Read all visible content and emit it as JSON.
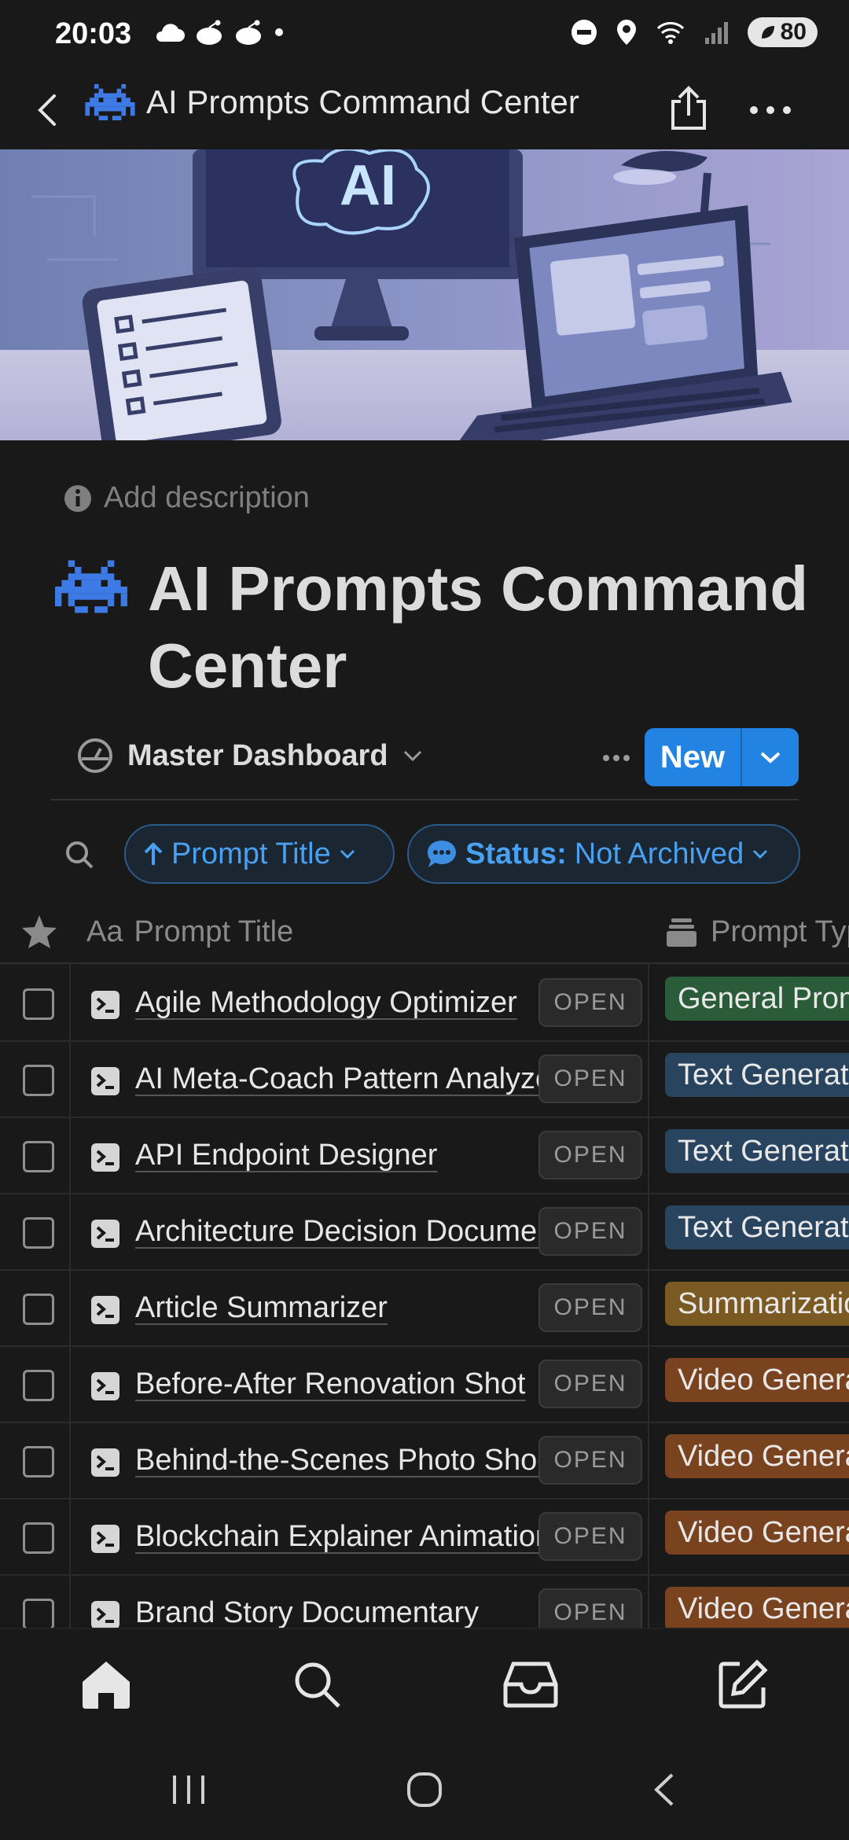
{
  "status_bar": {
    "time": "20:03",
    "battery": "80"
  },
  "nav": {
    "title": "AI Prompts Command Center"
  },
  "cover": {
    "screen_text": "AI"
  },
  "page": {
    "add_description": "Add description",
    "title": "AI Prompts Command Center"
  },
  "view": {
    "name": "Master Dashboard",
    "new_label": "New"
  },
  "filters": {
    "sort_label": "Prompt Title",
    "status_key": "Status:",
    "status_value": "Not Archived"
  },
  "table": {
    "col_title": "Prompt Title",
    "col_type": "Prompt Type",
    "open_label": "OPEN",
    "rows": [
      {
        "title": "Agile Methodology Optimizer",
        "type": "General Prompt",
        "type_color": "#2b5c3a"
      },
      {
        "title": "AI Meta-Coach Pattern Analyzer",
        "type": "Text Generation",
        "type_color": "#28445e"
      },
      {
        "title": "API Endpoint Designer",
        "type": "Text Generation",
        "type_color": "#28445e"
      },
      {
        "title": "Architecture Decision Document",
        "type": "Text Generation",
        "type_color": "#28445e"
      },
      {
        "title": "Article Summarizer",
        "type": "Summarization",
        "type_color": "#7a5a22"
      },
      {
        "title": "Before-After Renovation Shot",
        "type": "Video Generation",
        "type_color": "#7a4320"
      },
      {
        "title": "Behind-the-Scenes Photo Shoot",
        "type": "Video Generation",
        "type_color": "#7a4320"
      },
      {
        "title": "Blockchain Explainer Animation",
        "type": "Video Generation",
        "type_color": "#7a4320"
      },
      {
        "title": "Brand Story Documentary",
        "type": "Video Generation",
        "type_color": "#7a4320"
      }
    ]
  }
}
